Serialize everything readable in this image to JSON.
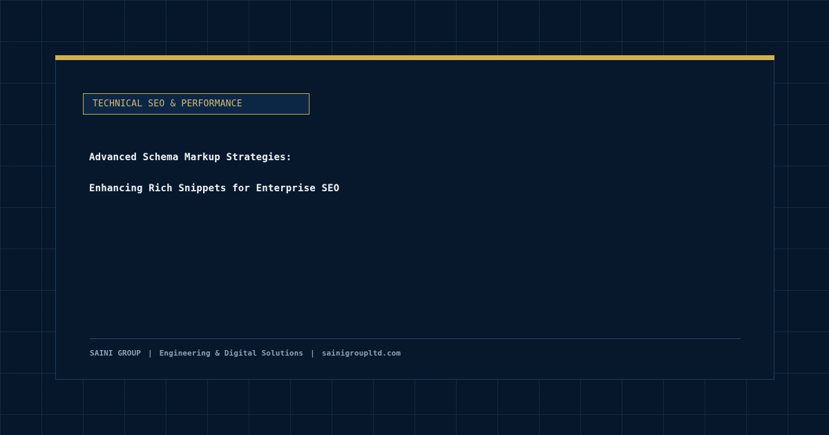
{
  "category": "TECHNICAL SEO & PERFORMANCE",
  "title": {
    "line1": "Advanced Schema Markup Strategies:",
    "line2": "Enhancing Rich Snippets for Enterprise SEO"
  },
  "footer": {
    "company": "SAINI GROUP",
    "tagline": "Engineering & Digital Solutions",
    "website": "sainigroupltd.com",
    "separator": "|"
  },
  "colors": {
    "background": "#06172b",
    "accent": "#d4b04f",
    "title": "#f2f4f7",
    "footer_text": "#8fa0b6"
  }
}
